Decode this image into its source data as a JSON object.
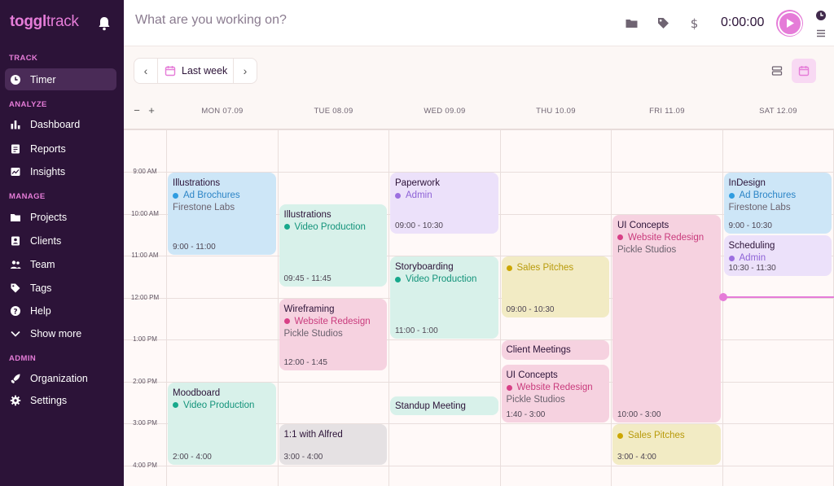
{
  "app": {
    "logo_bold": "toggl",
    "logo_light": "track"
  },
  "sidebar": {
    "sections": [
      {
        "label": "TRACK",
        "items": [
          {
            "label": "Timer",
            "icon": "clock-icon",
            "active": true
          }
        ]
      },
      {
        "label": "ANALYZE",
        "items": [
          {
            "label": "Dashboard",
            "icon": "dashboard-icon"
          },
          {
            "label": "Reports",
            "icon": "reports-icon"
          },
          {
            "label": "Insights",
            "icon": "insights-icon"
          }
        ]
      },
      {
        "label": "MANAGE",
        "items": [
          {
            "label": "Projects",
            "icon": "folder-icon"
          },
          {
            "label": "Clients",
            "icon": "clients-icon"
          },
          {
            "label": "Team",
            "icon": "team-icon"
          },
          {
            "label": "Tags",
            "icon": "tag-icon"
          },
          {
            "label": "Help",
            "icon": "help-icon"
          },
          {
            "label": "Show more",
            "icon": "chevron-down-icon"
          }
        ]
      },
      {
        "label": "ADMIN",
        "items": [
          {
            "label": "Organization",
            "icon": "rocket-icon"
          },
          {
            "label": "Settings",
            "icon": "gear-icon"
          }
        ]
      }
    ]
  },
  "topbar": {
    "placeholder": "What are you working on?",
    "timer": "0:00:00"
  },
  "toolbar": {
    "period_label": "Last week"
  },
  "calendar": {
    "days": [
      "MON 07.09",
      "TUE 08.09",
      "WED 09.09",
      "THU 10.09",
      "FRI 11.09",
      "SAT 12.09"
    ],
    "hours": [
      "9:00 AM",
      "10:00 AM",
      "11:00 AM",
      "12:00 PM",
      "1:00 PM",
      "2:00 PM",
      "3:00 PM",
      "4:00 PM"
    ],
    "colors": {
      "blue": {
        "bg": "#cde6f7",
        "dot": "#2f9ce0",
        "text": "#2b84c6"
      },
      "teal": {
        "bg": "#d8f1ea",
        "dot": "#17a98c",
        "text": "#12937a"
      },
      "purple": {
        "bg": "#ece1fa",
        "dot": "#9c6fe0",
        "text": "#8d62d6"
      },
      "pink": {
        "bg": "#f6d2e0",
        "dot": "#d83f86",
        "text": "#c93a7c"
      },
      "yellow": {
        "bg": "#f2ebc4",
        "dot": "#cca600",
        "text": "#b89a0a"
      },
      "gray": {
        "bg": "#e5e1e3",
        "dot": "#888888",
        "text": "#555555"
      }
    },
    "entries": [
      {
        "day": 0,
        "start": 9,
        "end": 11,
        "title": "Illustrations",
        "project": "Ad Brochures",
        "client": "Firestone Labs",
        "time": "9:00 - 11:00",
        "color": "blue"
      },
      {
        "day": 0,
        "start": 14,
        "end": 16,
        "title": "Moodboard",
        "project": "Video Production",
        "client": "",
        "time": "2:00 - 4:00",
        "color": "teal"
      },
      {
        "day": 1,
        "start": 9.75,
        "end": 11.75,
        "title": "Illustrations",
        "project": "Video Production",
        "client": "",
        "time": "09:45 - 11:45",
        "color": "teal"
      },
      {
        "day": 1,
        "start": 12,
        "end": 13.75,
        "title": "Wireframing",
        "project": "Website Redesign",
        "client": "Pickle Studios",
        "time": "12:00 - 1:45",
        "color": "pink"
      },
      {
        "day": 1,
        "start": 15,
        "end": 16,
        "title": "1:1 with Alfred",
        "project": "",
        "client": "",
        "time": "3:00 - 4:00",
        "color": "gray"
      },
      {
        "day": 2,
        "start": 9,
        "end": 10.5,
        "title": "Paperwork",
        "project": "Admin",
        "client": "",
        "time": "09:00 - 10:30",
        "color": "purple"
      },
      {
        "day": 2,
        "start": 11,
        "end": 13,
        "title": "Storyboarding",
        "project": "Video Production",
        "client": "",
        "time": "11:00 - 1:00",
        "color": "teal"
      },
      {
        "day": 2,
        "start": 14.333,
        "end": 14.833,
        "title": "Standup Meeting",
        "project": "",
        "client": "",
        "time": "",
        "color": "teal"
      },
      {
        "day": 3,
        "start": 11,
        "end": 12.5,
        "title": "",
        "project": "Sales Pitches",
        "client": "",
        "time": "09:00 - 10:30",
        "color": "yellow"
      },
      {
        "day": 3,
        "start": 13,
        "end": 13.5,
        "title": "Client Meetings",
        "project": "",
        "client": "",
        "time": "",
        "color": "pink"
      },
      {
        "day": 3,
        "start": 13.583,
        "end": 15,
        "title": "UI Concepts",
        "project": "Website Redesign",
        "client": "Pickle Studios",
        "time": "1:40 - 3:00",
        "color": "pink"
      },
      {
        "day": 4,
        "start": 10,
        "end": 15,
        "title": "UI Concepts",
        "project": "Website Redesign",
        "client": "Pickle Studios",
        "time": "10:00 - 3:00",
        "color": "pink"
      },
      {
        "day": 4,
        "start": 15,
        "end": 16,
        "title": "",
        "project": "Sales Pitches",
        "client": "",
        "time": "3:00 - 4:00",
        "color": "yellow"
      },
      {
        "day": 5,
        "start": 9,
        "end": 10.5,
        "title": "InDesign",
        "project": "Ad Brochures",
        "client": "Firestone Labs",
        "time": "9:00 - 10:30",
        "color": "blue"
      },
      {
        "day": 5,
        "start": 10.5,
        "end": 11.5,
        "title": "Scheduling",
        "project": "Admin",
        "client": "",
        "time": "10:30 - 11:30",
        "color": "purple"
      }
    ]
  },
  "accent": "#e57cd8"
}
